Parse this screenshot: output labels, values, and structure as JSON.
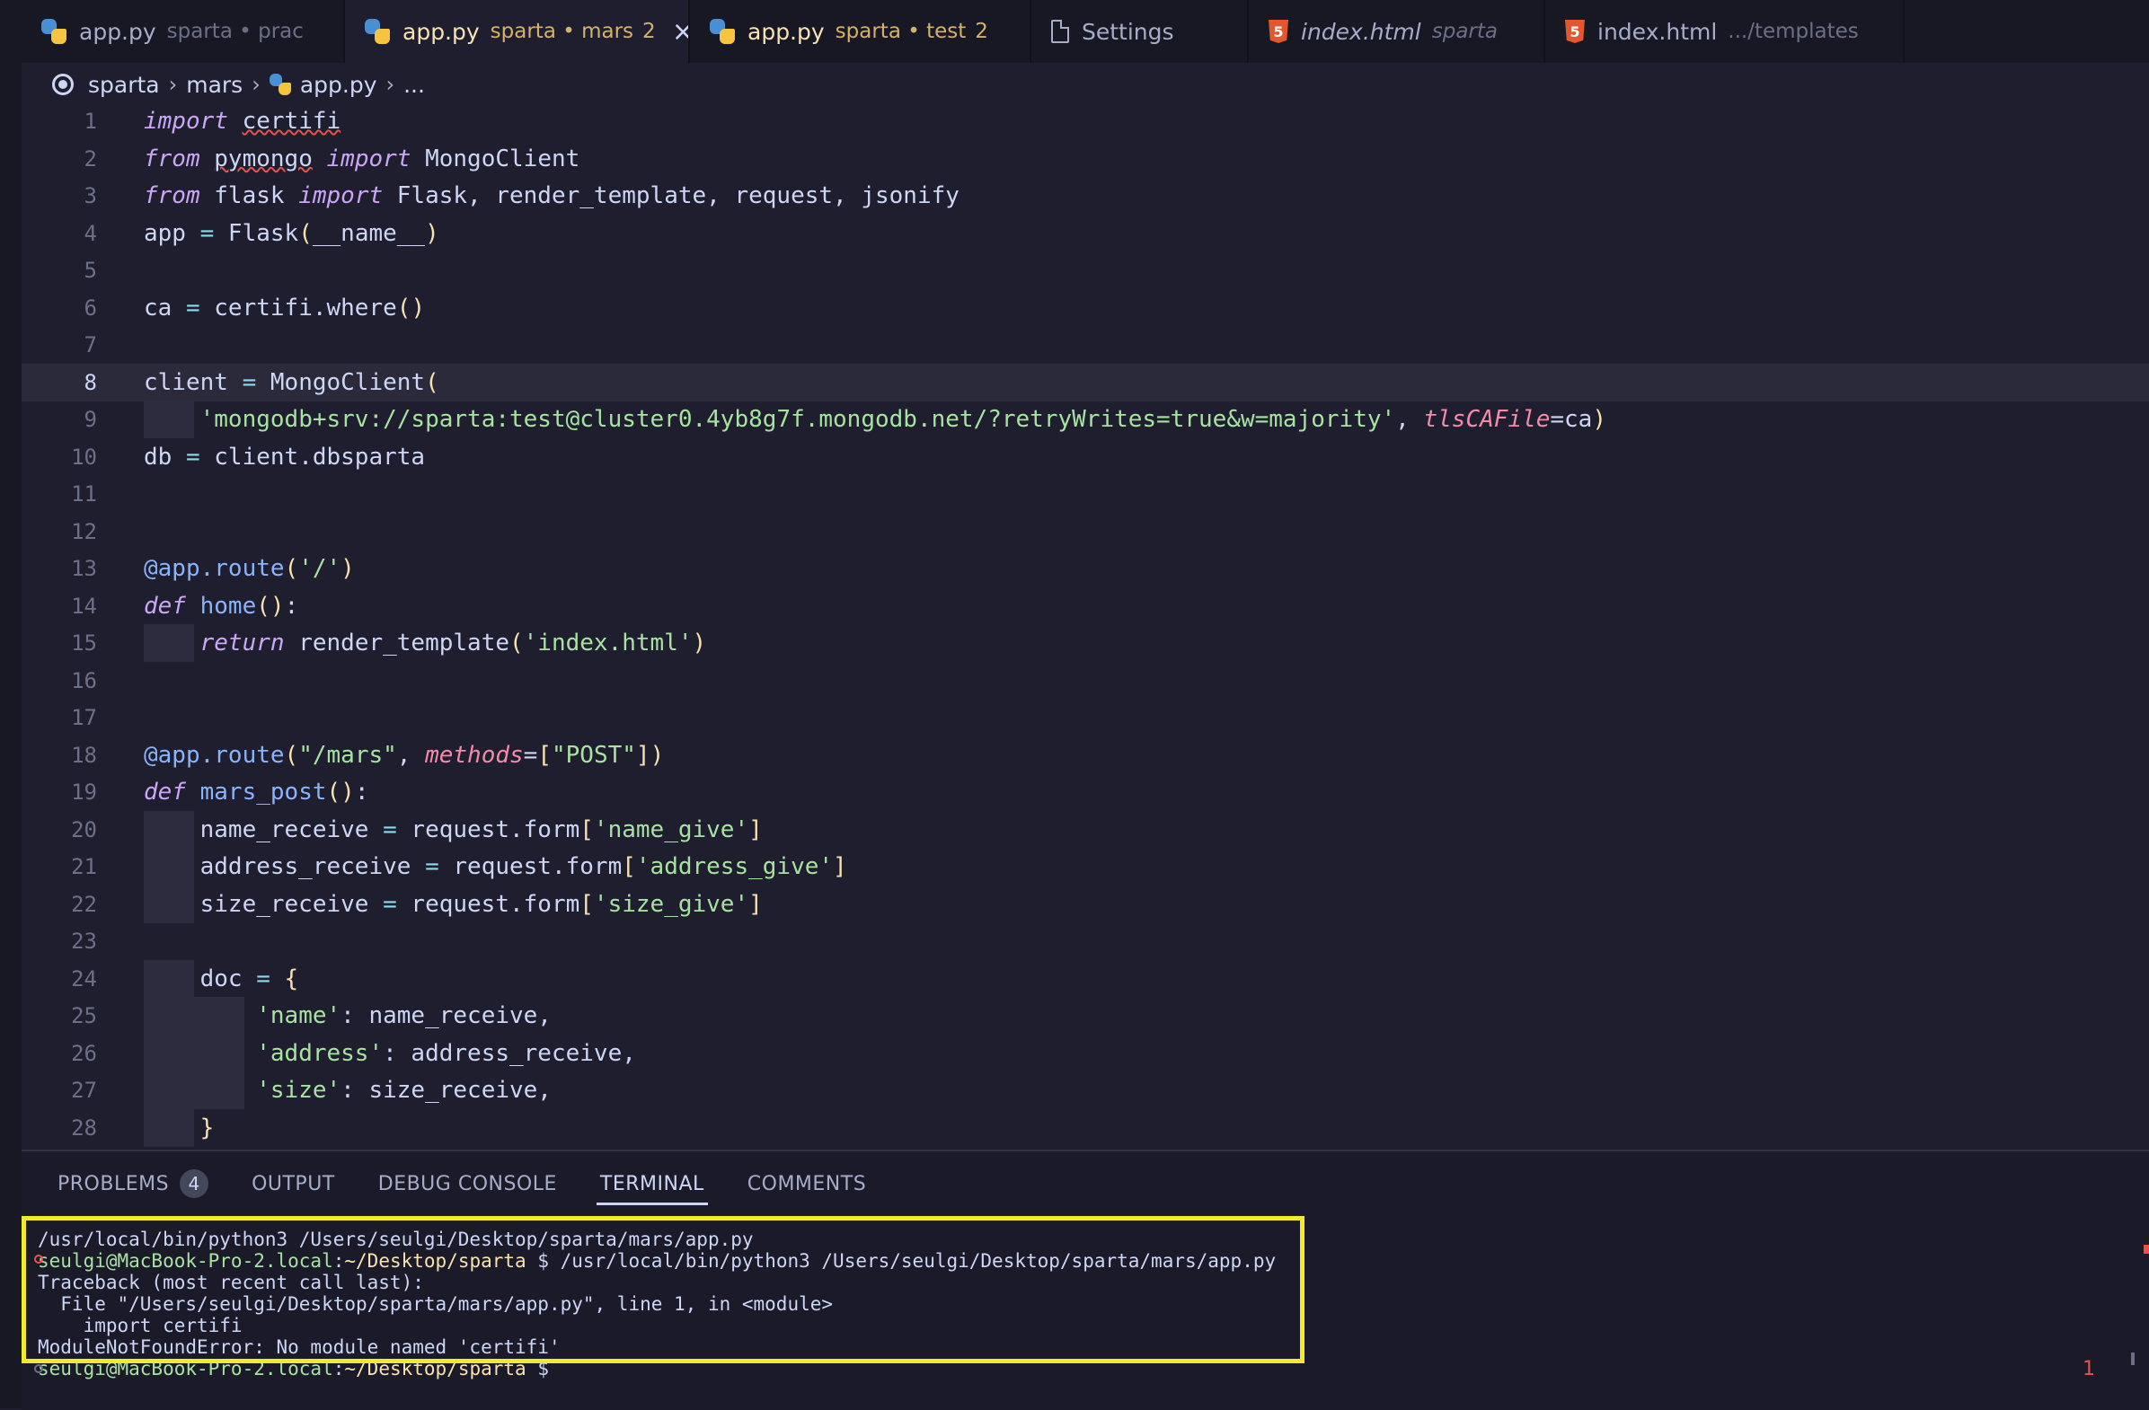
{
  "tabs": [
    {
      "name": "app.py",
      "desc": "sparta • prac",
      "icon": "python-icon",
      "modified": false,
      "active": false
    },
    {
      "name": "app.py",
      "desc": "sparta • mars",
      "count": "2",
      "icon": "python-icon",
      "modified": true,
      "active": true,
      "close": "×"
    },
    {
      "name": "app.py",
      "desc": "sparta • test",
      "count": "2",
      "icon": "python-icon",
      "modified": true,
      "active": false
    },
    {
      "name": "Settings",
      "desc": "",
      "icon": "file-icon",
      "active": false
    },
    {
      "name": "index.html",
      "desc": "sparta",
      "icon": "html5-icon",
      "italic": true,
      "active": false
    },
    {
      "name": "index.html",
      "desc": ".../templates",
      "icon": "html5-icon",
      "active": false
    }
  ],
  "breadcrumb": {
    "root": "sparta",
    "folder": "mars",
    "file": "app.py",
    "more": "...",
    "sep": "›"
  },
  "editor": {
    "current_line": 8,
    "line_numbers": [
      "1",
      "2",
      "3",
      "4",
      "5",
      "6",
      "7",
      "8",
      "9",
      "10",
      "11",
      "12",
      "13",
      "14",
      "15",
      "16",
      "17",
      "18",
      "19",
      "20",
      "21",
      "22",
      "23",
      "24",
      "25",
      "26",
      "27",
      "28"
    ],
    "lines": [
      "import certifi",
      "from pymongo import MongoClient",
      "from flask import Flask, render_template, request, jsonify",
      "app = Flask(__name__)",
      "",
      "ca = certifi.where()",
      "",
      "client = MongoClient(",
      "    'mongodb+srv://sparta:test@cluster0.4yb8g7f.mongodb.net/?retryWrites=true&w=majority', tlsCAFile=ca)",
      "db = client.dbsparta",
      "",
      "",
      "@app.route('/')",
      "def home():",
      "    return render_template('index.html')",
      "",
      "",
      "@app.route(\"/mars\", methods=[\"POST\"])",
      "def mars_post():",
      "    name_receive = request.form['name_give']",
      "    address_receive = request.form['address_give']",
      "    size_receive = request.form['size_give']",
      "",
      "    doc = {",
      "        'name': name_receive,",
      "        'address': address_receive,",
      "        'size': size_receive,",
      "    }"
    ]
  },
  "panel": {
    "tabs": [
      "PROBLEMS",
      "OUTPUT",
      "DEBUG CONSOLE",
      "TERMINAL",
      "COMMENTS"
    ],
    "active_tab": "TERMINAL",
    "problems_count": "4",
    "terminal": {
      "line1": "/usr/local/bin/python3 /Users/seulgi/Desktop/sparta/mars/app.py",
      "prompt_user": "seulgi@MacBook-Pro-2.local",
      "prompt_path": "~/Desktop/sparta",
      "prompt_cmd": " $ /usr/local/bin/python3 /Users/seulgi/Desktop/sparta/mars/app.py",
      "tb1": "Traceback (most recent call last):",
      "tb2": "  File \"/Users/seulgi/Desktop/sparta/mars/app.py\", line 1, in <module>",
      "tb3": "    import certifi",
      "tb4": "ModuleNotFoundError: No module named 'certifi'",
      "prompt2_user": "seulgi@MacBook-Pro-2.local",
      "prompt2_path": "~/Desktop/sparta",
      "prompt2_end": " $"
    },
    "error_count": "1"
  },
  "colors": {
    "highlight_box": "#f2ea2a",
    "background": "#1f1e2e",
    "error": "#e5534b"
  }
}
